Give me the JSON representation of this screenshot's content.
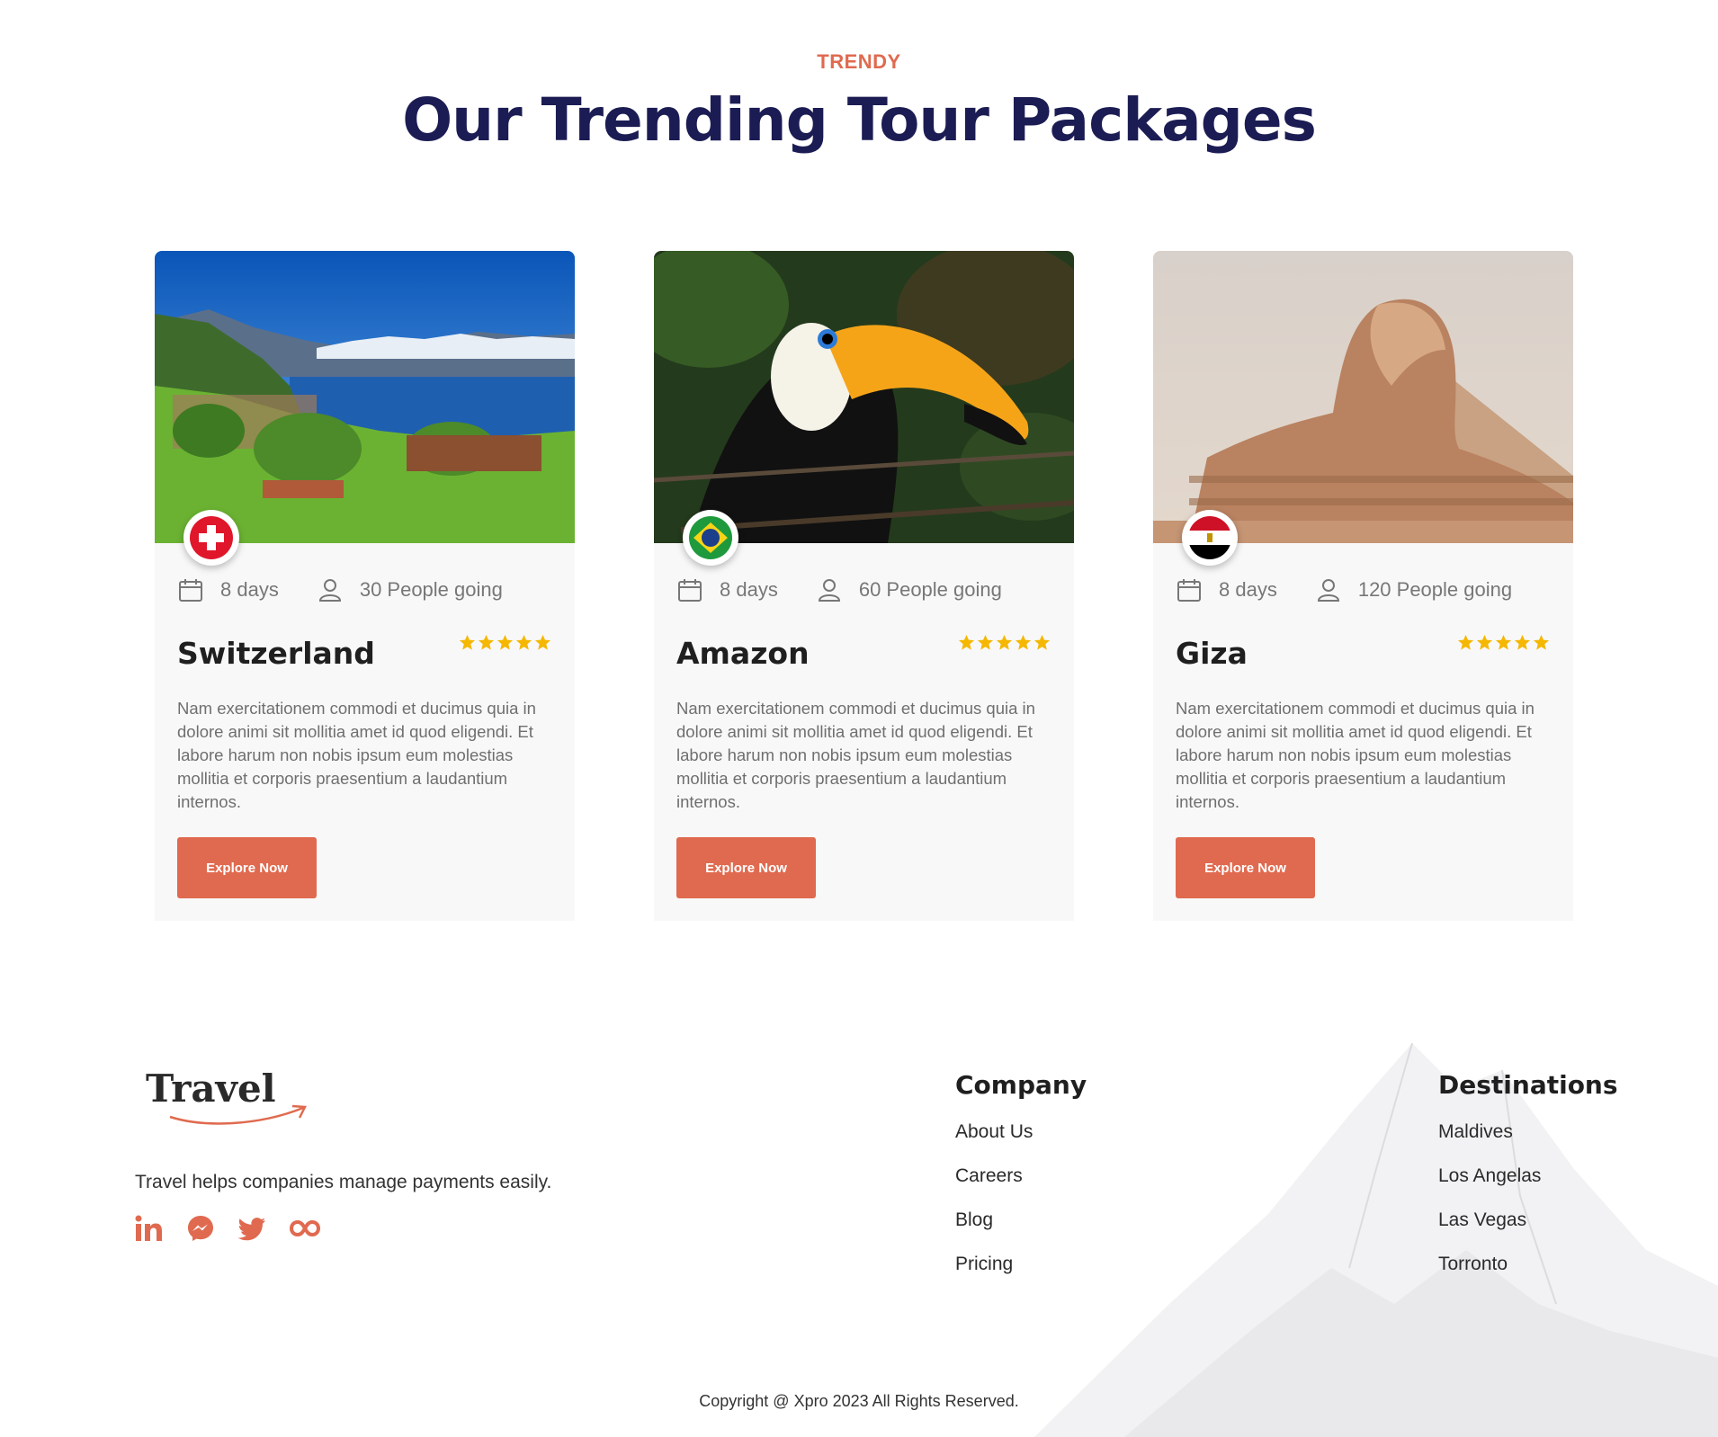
{
  "section": {
    "eyebrow": "TRENDY",
    "title": "Our Trending Tour Packages"
  },
  "cards": [
    {
      "title": "Switzerland",
      "flag": "switzerland-flag",
      "image": "swiss-lake-landscape",
      "days": "8 days",
      "people": "30 People going",
      "rating": 5,
      "description": "Nam exercitationem commodi et ducimus quia in dolore animi sit mollitia amet id quod eligendi. Et labore harum non nobis ipsum eum molestias mollitia et corporis praesentium a laudantium internos.",
      "button": "Explore Now"
    },
    {
      "title": "Amazon",
      "flag": "brazil-flag",
      "image": "toucan-bird",
      "days": "8 days",
      "people": "60 People going",
      "rating": 5,
      "description": "Nam exercitationem commodi et ducimus quia in dolore animi sit mollitia amet id quod eligendi. Et labore harum non nobis ipsum eum molestias mollitia et corporis praesentium a laudantium internos.",
      "button": "Explore Now"
    },
    {
      "title": "Giza",
      "flag": "egypt-flag",
      "image": "sphinx",
      "days": "8 days",
      "people": "120 People going",
      "rating": 5,
      "description": "Nam exercitationem commodi et ducimus quia in dolore animi sit mollitia amet id quod eligendi. Et labore harum non nobis ipsum eum molestias mollitia et corporis praesentium a laudantium internos.",
      "button": "Explore Now"
    }
  ],
  "footer": {
    "logo": "Travel",
    "tagline": "Travel helps companies manage payments easily.",
    "socials": [
      "linkedin-icon",
      "messenger-icon",
      "twitter-icon",
      "infinity-icon"
    ],
    "company": {
      "heading": "Company",
      "links": [
        "About Us",
        "Careers",
        "Blog",
        "Pricing"
      ]
    },
    "destinations": {
      "heading": "Destinations",
      "links": [
        "Maldives",
        "Los Angelas",
        "Las Vegas",
        "Torronto"
      ]
    },
    "copyright": "Copyright @ Xpro 2023 All Rights Reserved."
  },
  "colors": {
    "accent": "#e06a4f",
    "heading": "#1c1c54",
    "star": "#f5b700",
    "card_bg": "#f8f8f8"
  }
}
